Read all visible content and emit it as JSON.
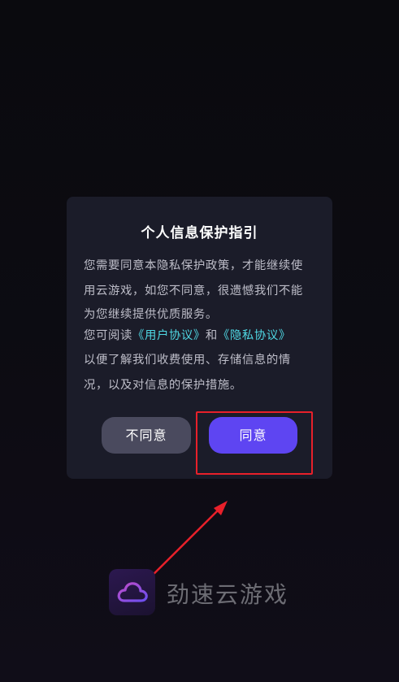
{
  "dialog": {
    "title": "个人信息保护指引",
    "body_lines": [
      "您需要同意本隐私保护政策，才能继续使",
      "用云游戏，如您不同意，很遗憾我们不能",
      "为您继续提供优质服务。"
    ],
    "read_prefix": "您可阅读",
    "user_agreement_link": "《用户协议》",
    "and_text": "和",
    "privacy_policy_link": "《隐私协议》",
    "closing_lines": [
      "以便了解我们收费使用、存储信息的情",
      "况，以及对信息的保护措施。"
    ],
    "disagree_label": "不同意",
    "agree_label": "同意"
  },
  "brand": {
    "name": "劲速云游戏",
    "logo_icon": "cloud-icon"
  },
  "colors": {
    "background": "#0c0b11",
    "dialog_bg": "#1b1c29",
    "link": "#4fd7e3",
    "agree_button": "#5e45f2",
    "disagree_button": "#4a4a5e",
    "annotation": "#e8202a"
  }
}
